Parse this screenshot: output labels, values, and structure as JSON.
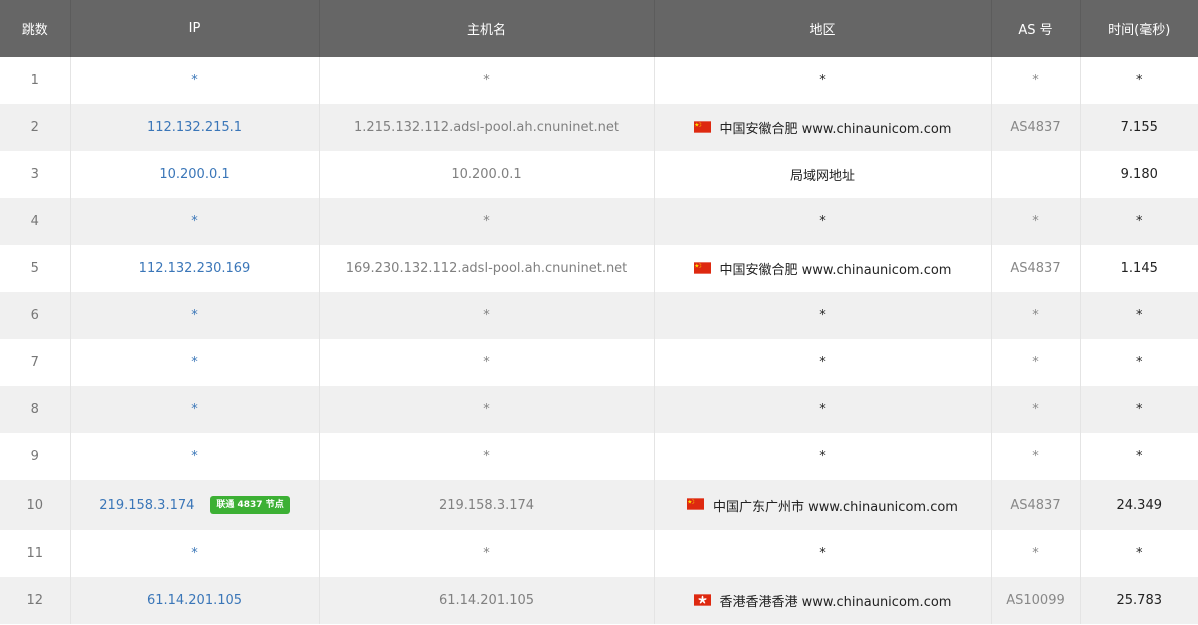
{
  "headers": [
    "跳数",
    "IP",
    "主机名",
    "地区",
    "AS 号",
    "时间(毫秒)"
  ],
  "rows": [
    {
      "hop": "1",
      "ip": "*",
      "host": "*",
      "flag": "",
      "region": "*",
      "as": "*",
      "time": "*"
    },
    {
      "hop": "2",
      "ip": "112.132.215.1",
      "host": "1.215.132.112.adsl-pool.ah.cnuninet.net",
      "flag": "china-flag",
      "region": "中国安徽合肥 www.chinaunicom.com",
      "as": "AS4837",
      "time": "7.155"
    },
    {
      "hop": "3",
      "ip": "10.200.0.1",
      "host": "10.200.0.1",
      "flag": "",
      "region": "局域网地址",
      "as": "",
      "time": "9.180"
    },
    {
      "hop": "4",
      "ip": "*",
      "host": "*",
      "flag": "",
      "region": "*",
      "as": "*",
      "time": "*"
    },
    {
      "hop": "5",
      "ip": "112.132.230.169",
      "host": "169.230.132.112.adsl-pool.ah.cnuninet.net",
      "flag": "china-flag",
      "region": "中国安徽合肥 www.chinaunicom.com",
      "as": "AS4837",
      "time": "1.145"
    },
    {
      "hop": "6",
      "ip": "*",
      "host": "*",
      "flag": "",
      "region": "*",
      "as": "*",
      "time": "*"
    },
    {
      "hop": "7",
      "ip": "*",
      "host": "*",
      "flag": "",
      "region": "*",
      "as": "*",
      "time": "*"
    },
    {
      "hop": "8",
      "ip": "*",
      "host": "*",
      "flag": "",
      "region": "*",
      "as": "*",
      "time": "*"
    },
    {
      "hop": "9",
      "ip": "*",
      "host": "*",
      "flag": "",
      "region": "*",
      "as": "*",
      "time": "*"
    },
    {
      "hop": "10",
      "ip": "219.158.3.174",
      "badge": "联通 4837 节点",
      "host": "219.158.3.174",
      "flag": "china-flag",
      "region": "中国广东广州市 www.chinaunicom.com",
      "as": "AS4837",
      "time": "24.349"
    },
    {
      "hop": "11",
      "ip": "*",
      "host": "*",
      "flag": "",
      "region": "*",
      "as": "*",
      "time": "*"
    },
    {
      "hop": "12",
      "ip": "61.14.201.105",
      "host": "61.14.201.105",
      "flag": "hong-kong-flag",
      "region": "香港香港香港 www.chinaunicom.com",
      "as": "AS10099",
      "time": "25.783"
    }
  ],
  "colors": {
    "header_bg": "#666666",
    "ip_link": "#3a76b8",
    "badge_bg": "#3cb034",
    "stripe_bg": "#f0f0f0"
  }
}
